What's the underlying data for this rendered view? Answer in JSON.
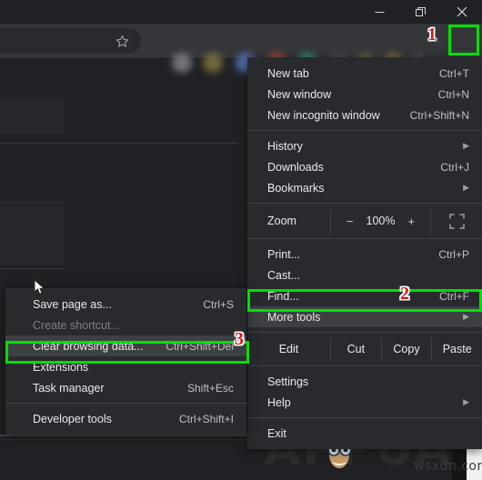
{
  "window": {
    "controls": [
      {
        "name": "minimize",
        "icon": "minimize-icon"
      },
      {
        "name": "maximize",
        "icon": "maximize-icon"
      },
      {
        "name": "close",
        "icon": "close-icon"
      }
    ]
  },
  "toolbar": {
    "bookmark_icon": "star-icon",
    "menu_button_icon": "three-dot-menu-icon",
    "extension_colors": [
      "#6f7378",
      "#7a6f3e",
      "#4b6ea8",
      "#a8443c",
      "#2e8b72",
      "#4a4d52",
      "#5d6b3a",
      "#8a6b3a",
      "#4a4d52"
    ]
  },
  "annotations": {
    "steps": [
      {
        "number": "1",
        "target": "three-dot-menu-button"
      },
      {
        "number": "2",
        "target": "more-tools-menu-item"
      },
      {
        "number": "3",
        "target": "clear-browsing-data-menu-item"
      }
    ],
    "highlight_color": "#00e000",
    "number_color": "#d21b1b"
  },
  "main_menu": {
    "items": [
      {
        "label": "New tab",
        "accel": "Ctrl+T",
        "arrow": false,
        "highlighted": false,
        "disabled": false
      },
      {
        "label": "New window",
        "accel": "Ctrl+N",
        "arrow": false,
        "highlighted": false,
        "disabled": false
      },
      {
        "label": "New incognito window",
        "accel": "Ctrl+Shift+N",
        "arrow": false,
        "highlighted": false,
        "disabled": false
      },
      {
        "separator": true
      },
      {
        "label": "History",
        "accel": "",
        "arrow": true,
        "highlighted": false,
        "disabled": false
      },
      {
        "label": "Downloads",
        "accel": "Ctrl+J",
        "arrow": false,
        "highlighted": false,
        "disabled": false
      },
      {
        "label": "Bookmarks",
        "accel": "",
        "arrow": true,
        "highlighted": false,
        "disabled": false
      },
      {
        "separator": true
      }
    ],
    "zoom_row": {
      "label": "Zoom",
      "minus": "−",
      "value": "100%",
      "plus": "+",
      "fullscreen_icon": "fullscreen-icon"
    },
    "items2": [
      {
        "label": "Print...",
        "accel": "Ctrl+P",
        "arrow": false,
        "highlighted": false,
        "disabled": false
      },
      {
        "label": "Cast...",
        "accel": "",
        "arrow": false,
        "highlighted": false,
        "disabled": false
      },
      {
        "label": "Find...",
        "accel": "Ctrl+F",
        "arrow": false,
        "highlighted": false,
        "disabled": false
      },
      {
        "label": "More tools",
        "accel": "",
        "arrow": true,
        "highlighted": true,
        "disabled": false
      }
    ],
    "edit_row": {
      "label": "Edit",
      "cut": "Cut",
      "copy": "Copy",
      "paste": "Paste"
    },
    "items3": [
      {
        "label": "Settings",
        "accel": "",
        "arrow": false,
        "highlighted": false,
        "disabled": false
      },
      {
        "label": "Help",
        "accel": "",
        "arrow": true,
        "highlighted": false,
        "disabled": false
      },
      {
        "separator": true
      },
      {
        "label": "Exit",
        "accel": "",
        "arrow": false,
        "highlighted": false,
        "disabled": false
      }
    ]
  },
  "submenu": {
    "items": [
      {
        "label": "Save page as...",
        "accel": "Ctrl+S",
        "highlighted": false,
        "disabled": false
      },
      {
        "label": "Create shortcut...",
        "accel": "",
        "highlighted": false,
        "disabled": true
      },
      {
        "label": "Clear browsing data...",
        "accel": "Ctrl+Shift+Del",
        "highlighted": true,
        "disabled": false
      },
      {
        "label": "Extensions",
        "accel": "",
        "highlighted": false,
        "disabled": false
      },
      {
        "label": "Task manager",
        "accel": "Shift+Esc",
        "highlighted": false,
        "disabled": false
      },
      {
        "separator": true
      },
      {
        "label": "Developer tools",
        "accel": "Ctrl+Shift+I",
        "highlighted": false,
        "disabled": false
      }
    ]
  },
  "watermark": {
    "brand": "APPUALS",
    "site": "wsxdn.com"
  }
}
